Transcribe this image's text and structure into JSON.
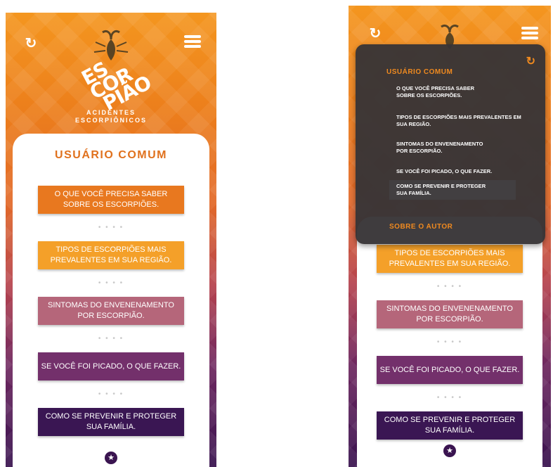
{
  "brand": {
    "logo_lines": [
      "ES",
      "COR",
      "PIÃO"
    ],
    "tagline_lines": [
      "ACIDENTES",
      "ESCORPIÔNICOS"
    ]
  },
  "icons": {
    "reload": "reload-icon",
    "menu": "hamburger-menu-icon",
    "star": "star-icon",
    "scorpion": "scorpion-icon"
  },
  "left_screen": {
    "card_title": "USUÁRIO COMUM",
    "menu_buttons": [
      {
        "line1": "O QUE VOCÊ PRECISA SABER",
        "line2": "SOBRE OS ESCORPIÕES.",
        "color": "#e8781f"
      },
      {
        "line1": "TIPOS DE ESCORPIÕES MAIS",
        "line2": "PREVALENTES EM SUA REGIÃO.",
        "color": "#f4a029"
      },
      {
        "line1": "SINTOMAS DO ENVENENAMENTO",
        "line2": "POR ESCORPIÃO.",
        "color": "#b5667a"
      },
      {
        "line1": "SE VOCÊ FOI PICADO, O QUE FAZER.",
        "line2": "",
        "color": "#73306b"
      },
      {
        "line1": "COMO SE PREVENIR E PROTEGER",
        "line2": "SUA FAMÍLIA.",
        "color": "#3a1653"
      }
    ],
    "separator": "• • • •"
  },
  "right_screen": {
    "overlay_menu": {
      "section1": "USUÁRIO COMUM",
      "items": [
        {
          "line1": "O QUE VOCÊ PRECISA SABER",
          "line2": "SOBRE OS ESCORPIÕES."
        },
        {
          "line1": "TIPOS DE ESCORPIÕES MAIS PREVALENTES EM",
          "line2": "SUA REGIÃO."
        },
        {
          "line1": "SINTOMAS DO ENVENENAMENTO",
          "line2": "POR ESCORPIÃO."
        },
        {
          "line1": "SE VOCÊ FOI PICADO, O QUE FAZER.",
          "line2": ""
        },
        {
          "line1": "COMO SE PREVENIR E PROTEGER",
          "line2": "SUA FAMÍLIA."
        }
      ],
      "section2": "SOBRE O AUTOR"
    },
    "menu_buttons": [
      {
        "line1": "TIPOS DE ESCORPIÕES MAIS",
        "line2": "PREVALENTES EM SUA REGIÃO."
      },
      {
        "line1": "SINTOMAS DO ENVENENAMENTO",
        "line2": "POR ESCORPIÃO."
      },
      {
        "line1": "SE VOCÊ FOI PICADO, O QUE FAZER.",
        "line2": ""
      },
      {
        "line1": "COMO SE PREVENIR E PROTEGER",
        "line2": "SUA FAMÍLIA."
      }
    ],
    "separator": "• • • •"
  }
}
